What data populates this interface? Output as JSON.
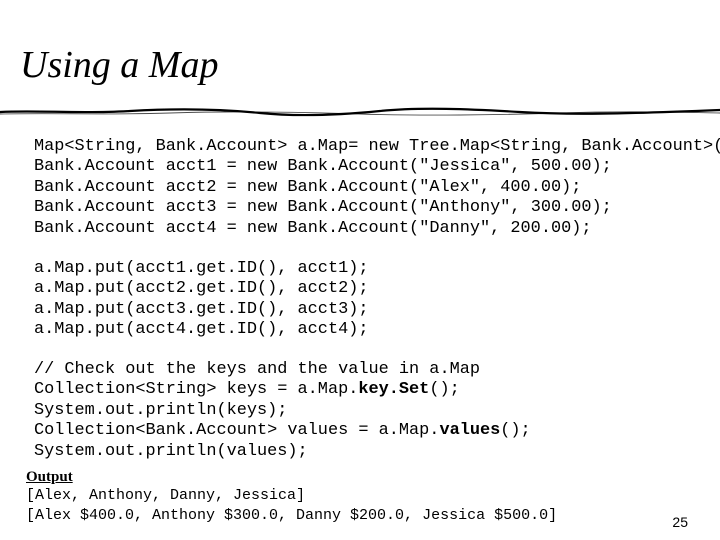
{
  "slide": {
    "title": "Using a Map",
    "page_number": "25"
  },
  "declarations": [
    [
      {
        "t": "Map<String, Bank.Account> a.Map= "
      },
      {
        "t": "new",
        "c": "kw"
      },
      {
        "t": " Tree.Map<String, Bank.Account>();"
      }
    ],
    [
      {
        "t": "Bank.Account acct1 = "
      },
      {
        "t": "new",
        "c": "kw"
      },
      {
        "t": " Bank.Account("
      },
      {
        "t": "\"Jessica\"",
        "c": "str"
      },
      {
        "t": ", 500.00);"
      }
    ],
    [
      {
        "t": "Bank.Account acct2 = "
      },
      {
        "t": "new",
        "c": "kw"
      },
      {
        "t": " Bank.Account("
      },
      {
        "t": "\"Alex\"",
        "c": "str"
      },
      {
        "t": ", 400.00);"
      }
    ],
    [
      {
        "t": "Bank.Account acct3 = "
      },
      {
        "t": "new",
        "c": "kw"
      },
      {
        "t": " Bank.Account("
      },
      {
        "t": "\"Anthony\"",
        "c": "str"
      },
      {
        "t": ", 300.00);"
      }
    ],
    [
      {
        "t": "Bank.Account acct4 = "
      },
      {
        "t": "new",
        "c": "kw"
      },
      {
        "t": " Bank.Account("
      },
      {
        "t": "\"Danny\"",
        "c": "str"
      },
      {
        "t": ", 200.00);"
      }
    ]
  ],
  "puts": [
    [
      {
        "t": "a.Map.put(acct1.get.ID(), acct1);"
      }
    ],
    [
      {
        "t": "a.Map.put(acct2.get.ID(), acct2);"
      }
    ],
    [
      {
        "t": "a.Map.put(acct3.get.ID(), acct3);"
      }
    ],
    [
      {
        "t": "a.Map.put(acct4.get.ID(), acct4);"
      }
    ]
  ],
  "collection_code": [
    [
      {
        "t": "// Check out the keys and the value in a.Map",
        "c": "comment"
      }
    ],
    [
      {
        "t": "Collection<String> keys = a.Map."
      },
      {
        "t": "key.Set",
        "c": "bold"
      },
      {
        "t": "();"
      }
    ],
    [
      {
        "t": "System.out.println(keys);"
      }
    ],
    [
      {
        "t": "Collection<Bank.Account> values = a.Map."
      },
      {
        "t": "values",
        "c": "bold"
      },
      {
        "t": "();"
      }
    ],
    [
      {
        "t": "System.out.println(values);"
      }
    ]
  ],
  "output": {
    "label": "Output",
    "line1": "[Alex, Anthony, Danny, Jessica]",
    "line2": "[Alex $400.0, Anthony $300.0, Danny $200.0, Jessica $500.0]"
  },
  "colors": {
    "background": "#ffffff",
    "text": "#000000",
    "rule": "#000000"
  }
}
